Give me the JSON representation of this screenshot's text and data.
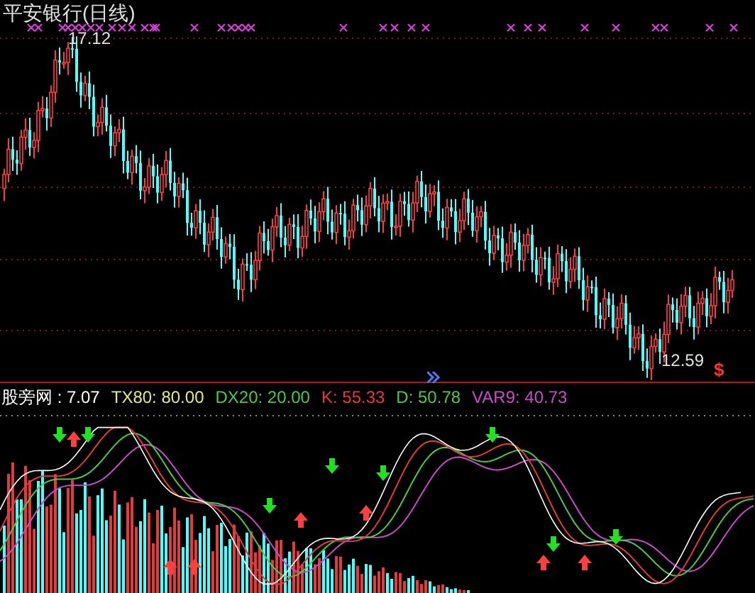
{
  "chart_title": "平安银行(日线)",
  "price_labels": [
    {
      "kind": "high",
      "text": "17.12"
    },
    {
      "kind": "low",
      "text": "12.59"
    }
  ],
  "signal_mark": "$",
  "indicator_legend": [
    {
      "text": "股旁网 : 7.07",
      "color": "#ffffff"
    },
    {
      "text": "TX80: 80.00",
      "color": "#e6e68a"
    },
    {
      "text": "DX20: 20.00",
      "color": "#4cc84c"
    },
    {
      "text": "K: 55.33",
      "color": "#e03c3c"
    },
    {
      "text": "D: 50.78",
      "color": "#4cc84c"
    },
    {
      "text": "VAR9: 40.73",
      "color": "#c84cc8"
    }
  ]
}
